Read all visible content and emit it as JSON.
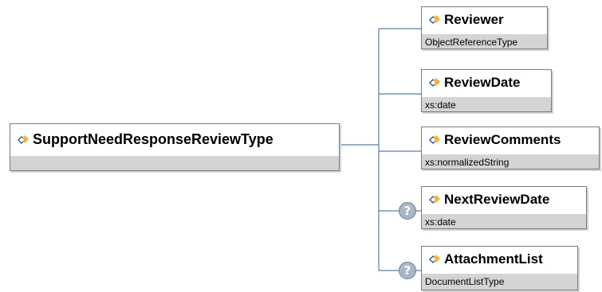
{
  "root": {
    "name": "SupportNeedResponseReviewType",
    "type": ""
  },
  "children": [
    {
      "name": "Reviewer",
      "type": "ObjectReferenceType",
      "optional": false
    },
    {
      "name": "ReviewDate",
      "type": "xs:date",
      "optional": false
    },
    {
      "name": "ReviewComments",
      "type": "xs:normalizedString",
      "optional": false
    },
    {
      "name": "NextReviewDate",
      "type": "xs:date",
      "optional": true
    },
    {
      "name": "AttachmentList",
      "type": "DocumentListType",
      "optional": true
    }
  ],
  "icons": {
    "element": "element-diamond-icon",
    "optional": "question-mark-icon"
  },
  "optional_symbol": "?",
  "colors": {
    "connector": "#5b7fa6",
    "band": "#d4d4d4",
    "border": "#7a7a7a",
    "icon_blue": "#2c5f9b",
    "icon_gold": "#f0b43c"
  }
}
